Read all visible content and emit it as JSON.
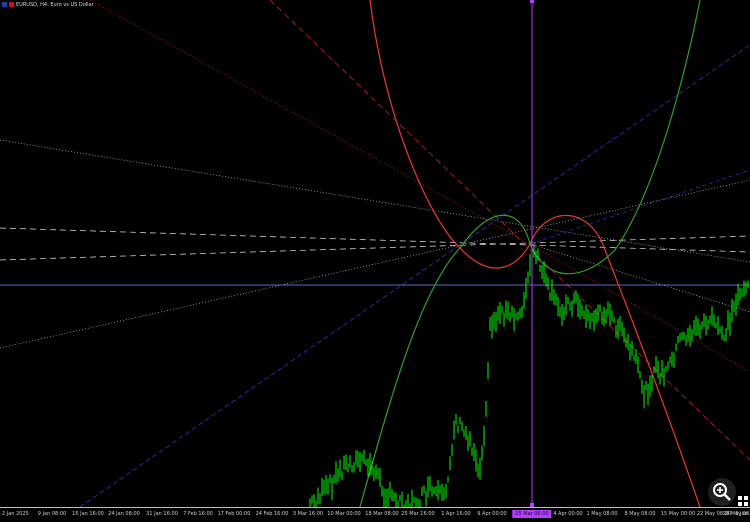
{
  "window": {
    "title": "EURUSD, H4: Euro vs US Dollar"
  },
  "colors": {
    "background": "#000000",
    "price_bars": "#00ff00",
    "red_curve": "#e53935",
    "green_curve": "#2e9e2e",
    "vertical_line": "#b43cff",
    "horizontal_line": "#7f8cff",
    "blue_diagonal": "#2233aa",
    "grey_trendlines": "#bdbdbd",
    "red_dashed": "#cc2222",
    "axis_text": "#cfcfcf"
  },
  "time_axis": {
    "labels": [
      "2 Jan 2025",
      "9 Jan 08:00",
      "16 Jan 16:00",
      "24 Jan 08:00",
      "31 Jan 16:00",
      "7 Feb 16:00",
      "17 Feb 00:00",
      "24 Feb 16:00",
      "3 Mar 16:00",
      "10 Mar 00:00",
      "18 Mar 08:00",
      "25 Mar 16:00",
      "1 Apr 16:00",
      "9 Apr 00:00",
      "4 Apr 00:00",
      "1 May 08:00",
      "8 May 08:00",
      "15 May 00:00",
      "22 May 08:00",
      "28 May 08:00",
      "6 Jun"
    ],
    "cursor_label": "25 Mar 06:00"
  },
  "icons": {
    "zoom": "zoom-in-icon",
    "grid": "grid-icon"
  }
}
